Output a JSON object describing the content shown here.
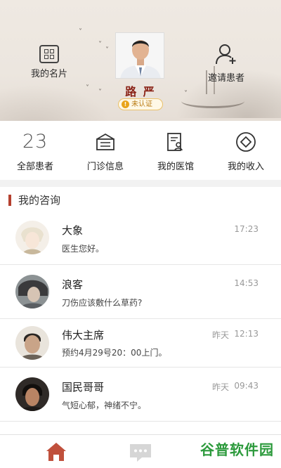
{
  "header": {
    "my_card_label": "我的名片",
    "invite_label": "邀请患者",
    "doctor_name": "路 严",
    "badge_label": "未认证"
  },
  "stats": [
    {
      "value": "23",
      "label": "全部患者",
      "icon": "number"
    },
    {
      "label": "门诊信息",
      "icon": "clinic-icon"
    },
    {
      "label": "我的医馆",
      "icon": "hospital-doc-icon"
    },
    {
      "label": "我的收入",
      "icon": "income-icon"
    }
  ],
  "section": {
    "title": "我的咨询"
  },
  "consultations": [
    {
      "name": "大象",
      "message": "医生您好。",
      "day": "",
      "time": "17:23"
    },
    {
      "name": "浪客",
      "message": "刀伤应该敷什么草药?",
      "day": "",
      "time": "14:53"
    },
    {
      "name": "伟大主席",
      "message": "预约4月29号20：00上门。",
      "day": "昨天",
      "time": "12:13"
    },
    {
      "name": "国民哥哥",
      "message": "气短心郁，神绪不宁。",
      "day": "昨天",
      "time": "09:43"
    }
  ],
  "tabbar": {
    "home_icon": "home-icon",
    "chat_icon": "chat-icon"
  },
  "watermark": {
    "text": "谷普软件园"
  },
  "colors": {
    "accent": "#b5402f",
    "name": "#8b2418",
    "badge": "#e9a419"
  }
}
